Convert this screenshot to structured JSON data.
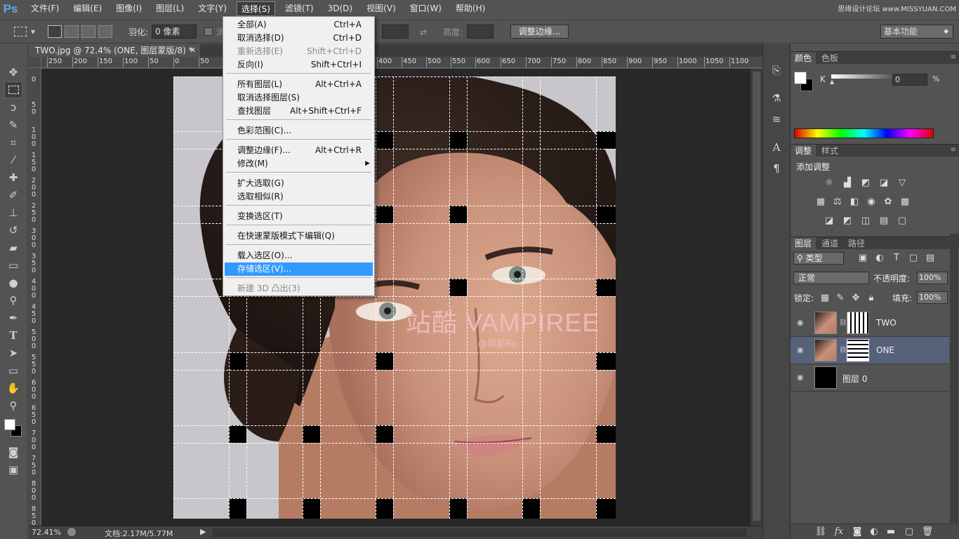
{
  "app": {
    "logo": "Ps",
    "watermark": "思缘设计论坛 www.MISSYUAN.COM"
  },
  "menubar": {
    "items": [
      "文件(F)",
      "编辑(E)",
      "图像(I)",
      "图层(L)",
      "文字(Y)",
      "选择(S)",
      "滤镜(T)",
      "3D(D)",
      "视图(V)",
      "窗口(W)",
      "帮助(H)"
    ],
    "active": "选择(S)"
  },
  "options": {
    "feather_label": "羽化:",
    "feather_value": "0 像素",
    "antialias_label": "消除锯齿",
    "height_label": "高度:",
    "refine_edge_button": "调整边缘...",
    "workspace": "基本功能"
  },
  "document": {
    "tab_title": "TWO.jpg @ 72.4% (ONE, 图层蒙版/8) *",
    "watermark_title": "站酷 VAMPIREE",
    "watermark_sub": "@周鹏Ro",
    "ruler_h": [
      "250",
      "200",
      "150",
      "100",
      "50",
      "0",
      "50",
      "400",
      "450",
      "500",
      "550",
      "600",
      "650",
      "700",
      "750",
      "800",
      "850",
      "900",
      "950",
      "1000",
      "1050",
      "1100"
    ],
    "ruler_v": [
      "0",
      "5\n0",
      "1\n0\n0",
      "1\n5\n0",
      "2\n0\n0",
      "2\n5\n0",
      "3\n0\n0",
      "3\n5\n0",
      "4\n0\n0",
      "4\n5\n0",
      "5\n0\n0",
      "5\n5\n0",
      "6\n0\n0",
      "6\n5\n0",
      "7\n0\n0",
      "7\n5\n0",
      "8\n0\n0",
      "8\n5\n0"
    ]
  },
  "status": {
    "zoom": "72.41%",
    "doc_size": "文档:2.17M/5.77M"
  },
  "select_menu": {
    "items": [
      {
        "label": "全部(A)",
        "shortcut": "Ctrl+A",
        "state": "normal"
      },
      {
        "label": "取消选择(D)",
        "shortcut": "Ctrl+D",
        "state": "normal"
      },
      {
        "label": "重新选择(E)",
        "shortcut": "Shift+Ctrl+D",
        "state": "disabled"
      },
      {
        "label": "反向(I)",
        "shortcut": "Shift+Ctrl+I",
        "state": "normal"
      },
      {
        "label": "所有图层(L)",
        "shortcut": "Alt+Ctrl+A",
        "state": "normal"
      },
      {
        "label": "取消选择图层(S)",
        "shortcut": "",
        "state": "normal"
      },
      {
        "label": "查找图层",
        "shortcut": "Alt+Shift+Ctrl+F",
        "state": "normal"
      },
      {
        "label": "色彩范围(C)...",
        "shortcut": "",
        "state": "normal"
      },
      {
        "label": "调整边缘(F)...",
        "shortcut": "Alt+Ctrl+R",
        "state": "normal"
      },
      {
        "label": "修改(M)",
        "shortcut": "",
        "state": "submenu"
      },
      {
        "label": "扩大选取(G)",
        "shortcut": "",
        "state": "normal"
      },
      {
        "label": "选取相似(R)",
        "shortcut": "",
        "state": "normal"
      },
      {
        "label": "变换选区(T)",
        "shortcut": "",
        "state": "normal"
      },
      {
        "label": "在快速蒙版模式下编辑(Q)",
        "shortcut": "",
        "state": "normal"
      },
      {
        "label": "载入选区(O)...",
        "shortcut": "",
        "state": "normal"
      },
      {
        "label": "存储选区(V)...",
        "shortcut": "",
        "state": "highlighted"
      },
      {
        "label": "新建 3D 凸出(3)",
        "shortcut": "",
        "state": "disabled"
      }
    ]
  },
  "color_panel": {
    "tabs": [
      "颜色",
      "色板"
    ],
    "channel": "K",
    "value": "0",
    "unit": "%"
  },
  "adjust_panel": {
    "tabs": [
      "调整",
      "样式"
    ],
    "title": "添加调整"
  },
  "layers_panel": {
    "tabs": [
      "图层",
      "通道",
      "路径"
    ],
    "filter": "类型",
    "blend_mode": "正常",
    "opacity_label": "不透明度:",
    "opacity": "100%",
    "lock_label": "锁定:",
    "fill_label": "填充:",
    "fill": "100%",
    "layers": [
      {
        "name": "TWO",
        "selected": false
      },
      {
        "name": "ONE",
        "selected": true
      },
      {
        "name": "图层 0",
        "selected": false
      }
    ]
  }
}
